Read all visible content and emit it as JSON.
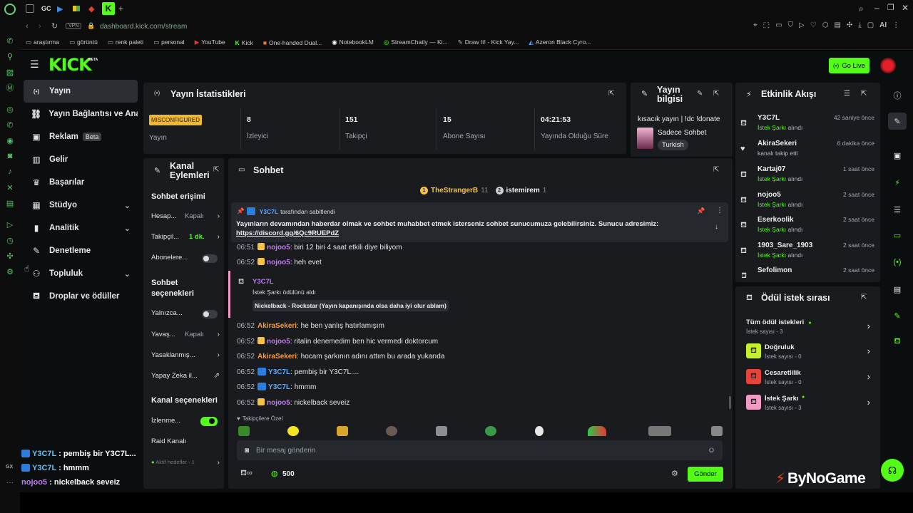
{
  "browser": {
    "url": "dashboard.kick.com/stream",
    "vpn_label": "VPN",
    "ai_label": "AI",
    "tab_labels": [
      "GC"
    ],
    "bookmarks": [
      "araştırma",
      "görüntü",
      "renk paleti",
      "personal",
      "YouTube",
      "Kick",
      "One-handed Dual...",
      "NotebookLM",
      "StreamChatly — Ki...",
      "Draw It! - Kick Yay...",
      "Azeron Black Cyro..."
    ]
  },
  "header": {
    "logo": "KICK",
    "logo_tag": "BETA",
    "go_live": "Go Live"
  },
  "sidebar": {
    "items": [
      {
        "label": "Yayın",
        "icon": "broadcast-icon",
        "glyph": "(•)"
      },
      {
        "label": "Yayın Bağlantısı ve Anahtarı",
        "icon": "link-icon",
        "glyph": "⛓"
      },
      {
        "label": "Reklam",
        "icon": "ad-icon",
        "glyph": "▣",
        "badge": "Beta"
      },
      {
        "label": "Gelir",
        "icon": "revenue-icon",
        "glyph": "▥"
      },
      {
        "label": "Başarılar",
        "icon": "trophy-icon",
        "glyph": "♛"
      },
      {
        "label": "Stüdyo",
        "icon": "studio-icon",
        "glyph": "▦",
        "chevron": true
      },
      {
        "label": "Analitik",
        "icon": "analytics-icon",
        "glyph": "▮",
        "chevron": true
      },
      {
        "label": "Denetleme",
        "icon": "wrench-icon",
        "glyph": "🔧"
      },
      {
        "label": "Topluluk",
        "icon": "community-icon",
        "glyph": "⚇",
        "chevron": true
      },
      {
        "label": "Droplar ve ödüller",
        "icon": "drops-icon",
        "glyph": "⛾"
      }
    ]
  },
  "stats": {
    "title": "Yayın İstatistikleri",
    "status_badge": "MISCONFIGURED",
    "status_label": "Yayın",
    "viewers": "8",
    "viewers_label": "İzleyici",
    "followers": "151",
    "followers_label": "Takipçi",
    "subs": "15",
    "subs_label": "Abone Sayısı",
    "uptime": "04:21:53",
    "uptime_label": "Yayında Olduğu Süre"
  },
  "stream_info": {
    "title": "Yayın bilgisi",
    "stream_title": "kısacık yayın | !dc !donate",
    "category": "Sadece Sohbet",
    "tag": "Turkish"
  },
  "channel_actions": {
    "title": "Kanal Eylemleri",
    "section1": "Sohbet erişimi",
    "rows1": [
      {
        "label": "Hesap...",
        "value": "Kapalı"
      },
      {
        "label": "Takipçil...",
        "value": "1 dk."
      },
      {
        "label": "Abonelere..."
      }
    ],
    "section2": "Sohbet seçenekleri",
    "rows2": [
      {
        "label": "Yalnızca..."
      },
      {
        "label": "Yavaş...",
        "value": "Kapalı"
      },
      {
        "label": "Yasaklanmış..."
      },
      {
        "label": "Yapay Zeka il..."
      }
    ],
    "section3": "Kanal seçenekleri",
    "rows3": [
      {
        "label": "İzlenme..."
      },
      {
        "label": "Raid Kanalı"
      },
      {
        "label": "Aktif hedefler - 1"
      }
    ]
  },
  "chat": {
    "title": "Sohbet",
    "top_gifters": [
      {
        "rank": "1",
        "name": "TheStrangerB",
        "count": "11"
      },
      {
        "rank": "2",
        "name": "istemirem",
        "count": "1"
      }
    ],
    "pinned_by": "Y3C7L",
    "pinned_suffix": "tarafından sabitlendi",
    "pinned_text": "Yayınların devamından haberdar olmak ve sohbet muhabbet etmek isterseniz sohbet sunucumuza gelebilirsiniz. Sunucu adresimiz:",
    "pinned_link": "https://discord.gg/6Qc9RUEPdZ",
    "messages": [
      {
        "time": "06:51",
        "user": "nojoo5",
        "color": "purple",
        "badge": "y",
        "text": "biri 12 biri 4 saat etkili diye biliyom"
      },
      {
        "time": "06:52",
        "user": "nojoo5",
        "color": "purple",
        "badge": "y",
        "text": "heh evet"
      },
      {
        "time": "06:52",
        "user": "AkiraSekeri",
        "color": "orange",
        "text": "he ben yanlış hatırlamışım"
      },
      {
        "time": "06:52",
        "user": "nojoo5",
        "color": "purple",
        "badge": "y",
        "text": "ritalin denemedim ben hic vermedi doktorcum"
      },
      {
        "time": "06:52",
        "user": "AkiraSekeri",
        "color": "orange",
        "text": "hocam şarkının adını attım bu arada yukarıda"
      },
      {
        "time": "06:52",
        "user": "Y3C7L",
        "color": "blue",
        "badge": "b",
        "text": "pembiş bir Y3C7L...."
      },
      {
        "time": "06:52",
        "user": "Y3C7L",
        "color": "blue",
        "badge": "b",
        "text": "hmmm"
      },
      {
        "time": "06:52",
        "user": "nojoo5",
        "color": "purple",
        "badge": "y",
        "text": "nickelback seveiz"
      }
    ],
    "reward": {
      "user": "Y3C7L",
      "action": "İstek Şarkı ödülünü aldı",
      "content": "Nickelback - Rockstar (Yayın kapanışında olsa daha iyi olur ablam)"
    },
    "followers_only": "Takipçilere Özel",
    "input_placeholder": "Bir mesaj gönderin",
    "points": "500",
    "send": "Gönder"
  },
  "activity": {
    "title": "Etkinlik Akışı",
    "items": [
      {
        "name": "Y3C7L",
        "reward": "İstek Şarkı",
        "suffix": "alındı",
        "time": "42 saniye önce"
      },
      {
        "name": "AkiraSekeri",
        "sub": "kanalı takip etti",
        "time": "6 dakika önce",
        "icon": "heart"
      },
      {
        "name": "Kartaj07",
        "reward": "İstek Şarkı",
        "suffix": "alındı",
        "time": "1 saat önce"
      },
      {
        "name": "nojoo5",
        "reward": "İstek Şarkı",
        "suffix": "alındı",
        "time": "2 saat önce"
      },
      {
        "name": "Eserkoolik",
        "reward": "İstek Şarkı",
        "suffix": "alındı",
        "time": "2 saat önce"
      },
      {
        "name": "1903_Sare_1903",
        "reward": "İstek Şarkı",
        "suffix": "alındı",
        "time": "2 saat önce"
      },
      {
        "name": "Sefolimon",
        "reward": "",
        "suffix": "",
        "time": "2 saat önce"
      }
    ]
  },
  "rewards": {
    "title": "Ödül istek sırası",
    "all": "Tüm ödül istekleri",
    "all_count": "İstek sayısı - 3",
    "items": [
      {
        "name": "Doğruluk",
        "count": "İstek sayısı - 0",
        "color": "#c6f02a"
      },
      {
        "name": "Cesaretlilik",
        "count": "İstek sayısı - 0",
        "color": "#e5443a"
      },
      {
        "name": "İstek Şarkı",
        "count": "İstek sayısı - 3",
        "color": "#f29ac4"
      }
    ]
  },
  "overlay": {
    "lines": [
      {
        "user": "Y3C7L",
        "text": "pembiş bir Y3C7L..."
      },
      {
        "user": "Y3C7L",
        "text": "hmmm"
      },
      {
        "user": "nojoo5",
        "text": "nickelback seveiz"
      }
    ],
    "watermark": "ByNoGame",
    "gx": "GX"
  }
}
